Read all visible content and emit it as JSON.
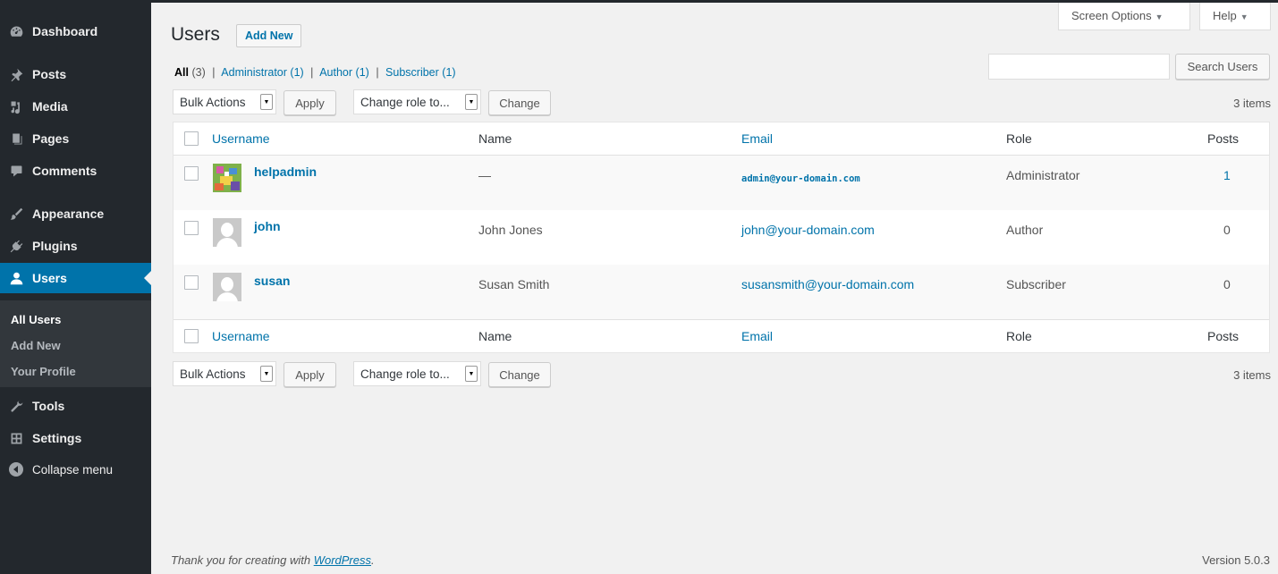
{
  "sidebar": {
    "items": [
      {
        "label": "Dashboard",
        "icon": "dashboard-icon"
      },
      {
        "label": "Posts",
        "icon": "pin-icon"
      },
      {
        "label": "Media",
        "icon": "media-icon"
      },
      {
        "label": "Pages",
        "icon": "pages-icon"
      },
      {
        "label": "Comments",
        "icon": "comment-icon"
      },
      {
        "label": "Appearance",
        "icon": "brush-icon"
      },
      {
        "label": "Plugins",
        "icon": "plug-icon"
      },
      {
        "label": "Users",
        "icon": "user-icon",
        "current": true
      },
      {
        "label": "Tools",
        "icon": "wrench-icon"
      },
      {
        "label": "Settings",
        "icon": "settings-icon"
      }
    ],
    "submenu": [
      "All Users",
      "Add New",
      "Your Profile"
    ],
    "collapse_label": "Collapse menu"
  },
  "header": {
    "screen_options": "Screen Options",
    "help": "Help",
    "title": "Users",
    "add_new": "Add New"
  },
  "filters": [
    {
      "label": "All",
      "count": "(3)",
      "current": true
    },
    {
      "label": "Administrator",
      "count": "(1)"
    },
    {
      "label": "Author",
      "count": "(1)"
    },
    {
      "label": "Subscriber",
      "count": "(1)"
    }
  ],
  "search": {
    "button": "Search Users",
    "value": ""
  },
  "tablenav": {
    "bulk_actions": "Bulk Actions",
    "apply": "Apply",
    "change_role": "Change role to...",
    "change": "Change",
    "items": "3 items"
  },
  "table": {
    "columns": [
      "Username",
      "Name",
      "Email",
      "Role",
      "Posts"
    ],
    "rows": [
      {
        "username": "helpadmin",
        "name": "—",
        "email": "admin@your-domain.com",
        "role": "Administrator",
        "posts": "1"
      },
      {
        "username": "john",
        "name": "John Jones",
        "email": "john@your-domain.com",
        "role": "Author",
        "posts": "0"
      },
      {
        "username": "susan",
        "name": "Susan Smith",
        "email": "susansmith@your-domain.com",
        "role": "Subscriber",
        "posts": "0"
      }
    ]
  },
  "footer": {
    "thanks_prefix": "Thank you for creating with ",
    "wordpress": "WordPress",
    "thanks_suffix": ".",
    "version": "Version 5.0.3"
  },
  "colors": {
    "accent": "#0073aa",
    "sidebar_bg": "#23282d",
    "submenu_bg": "#32373c",
    "page_bg": "#f1f1f1"
  }
}
